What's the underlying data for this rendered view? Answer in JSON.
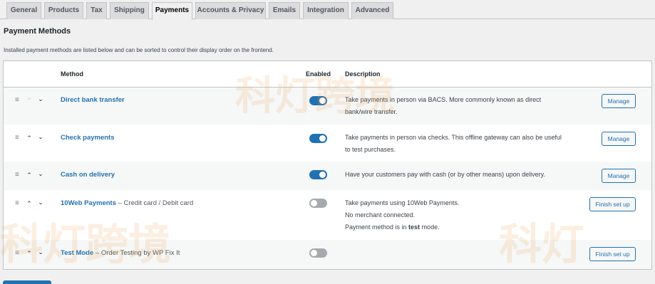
{
  "tabs": [
    {
      "label": "General"
    },
    {
      "label": "Products"
    },
    {
      "label": "Tax"
    },
    {
      "label": "Shipping"
    },
    {
      "label": "Payments",
      "active": true
    },
    {
      "label": "Accounts & Privacy"
    },
    {
      "label": "Emails"
    },
    {
      "label": "Integration"
    },
    {
      "label": "Advanced"
    }
  ],
  "page": {
    "title": "Payment Methods",
    "description": "Installed payment methods are listed below and can be sorted to control their display order on the frontend."
  },
  "table": {
    "headers": {
      "method": "Method",
      "enabled": "Enabled",
      "description": "Description"
    },
    "rows": [
      {
        "name": "Direct bank transfer",
        "suffix": "",
        "enabled": true,
        "desc1": "Take payments in person via BACS. More commonly known as direct",
        "desc2": "bank/wire transfer.",
        "desc3": "",
        "button": "Manage"
      },
      {
        "name": "Check payments",
        "suffix": "",
        "enabled": true,
        "desc1": "Take payments in person via checks. This offline gateway can also be useful",
        "desc2": "to test purchases.",
        "desc3": "",
        "button": "Manage"
      },
      {
        "name": "Cash on delivery",
        "suffix": "",
        "enabled": true,
        "desc1": "Have your customers pay with cash (or by other means) upon delivery.",
        "desc2": "",
        "desc3": "",
        "button": "Manage"
      },
      {
        "name": "10Web Payments",
        "suffix": " – Credit card / Debit card",
        "enabled": false,
        "desc1": "Take payments using 10Web Payments.",
        "desc2": "No merchant connected.",
        "desc3_pre": "Payment method is in ",
        "desc3_bold": "test",
        "desc3_post": " mode.",
        "button": "Finish set up"
      },
      {
        "name": "Test Mode",
        "suffix": " – Order Testing by WP Fix It",
        "enabled": false,
        "desc1": "",
        "desc2": "",
        "desc3": "",
        "button": "Finish set up"
      }
    ]
  },
  "icons": {
    "handle": "menu-handle-icon",
    "up": "chevron-up-icon",
    "down": "chevron-down-icon"
  },
  "colors": {
    "accent": "#2271b1",
    "toggle_off": "#a7aaad",
    "background": "#f0f0f1"
  },
  "watermark": {
    "text1": "科灯跨境",
    "text2": "科灯"
  }
}
